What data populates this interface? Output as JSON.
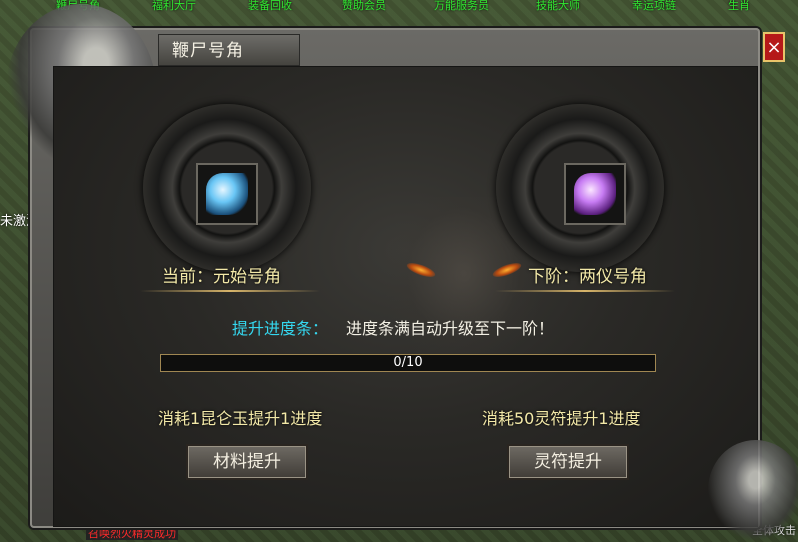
{
  "top_menu": [
    "鞭尸号角",
    "福利大厅",
    "装备回收",
    "赞助会员",
    "万能服务员",
    "技能大师",
    "幸运项链",
    "生肖"
  ],
  "left_text": "未激活",
  "bottom_red_text": "召唤烈火精灵成功",
  "bottom_right_text": "全体攻击",
  "dialog": {
    "title": "鞭尸号角",
    "close_label": "×",
    "current": {
      "label": "当前：元始号角",
      "icon": "horn-blue-icon"
    },
    "next": {
      "label": "下阶：两仪号角",
      "icon": "horn-purple-icon"
    },
    "progress_title": "提升进度条：",
    "progress_desc": "进度条满自动升级至下一阶！",
    "progress": {
      "current": 0,
      "max": 10,
      "text": "0/10"
    },
    "cost_material": "消耗1昆仑玉提升1进度",
    "cost_talisman": "消耗50灵符提升1进度",
    "btn_material": "材料提升",
    "btn_talisman": "灵符提升"
  },
  "colors": {
    "accent_cyan": "#35d7ef",
    "label_gold": "#f3e9a8",
    "close_red": "#b51919"
  }
}
